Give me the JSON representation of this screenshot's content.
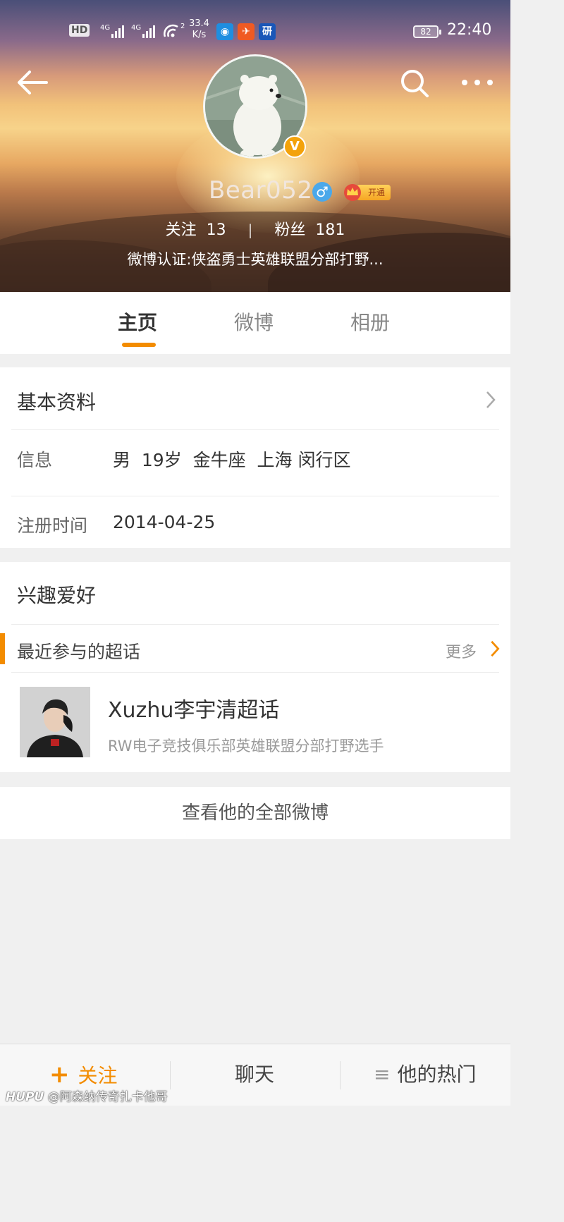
{
  "status_bar": {
    "hd": "HD",
    "net_1": "4G",
    "net_2": "4G",
    "hotspot_count": "2",
    "speed_value": "33.4",
    "speed_unit": "K/s",
    "app_badge_3": "研",
    "battery": "82",
    "time": "22:40"
  },
  "profile": {
    "name": "Bear052",
    "gender_symbol": "♂",
    "vip_label": "开通",
    "verified_badge": "V",
    "following_label": "关注",
    "following_count": "13",
    "separator": "|",
    "followers_label": "粉丝",
    "followers_count": "181",
    "verification": "微博认证:侠盗勇士英雄联盟分部打野..."
  },
  "tabs": [
    {
      "label": "主页",
      "active": true
    },
    {
      "label": "微博",
      "active": false
    },
    {
      "label": "相册",
      "active": false
    }
  ],
  "basic_info": {
    "title": "基本资料",
    "info_label": "信息",
    "info_value": "男  19岁  金牛座  上海 闵行区",
    "register_label": "注册时间",
    "register_value": "2014-04-25"
  },
  "interests": {
    "title": "兴趣爱好",
    "section_label": "最近参与的超话",
    "more": "更多",
    "topic": {
      "title": "Xuzhu李宇清超话",
      "subtitle": "RW电子竞技俱乐部英雄联盟分部打野选手"
    }
  },
  "all_posts": "查看他的全部微博",
  "bottom_bar": {
    "follow": "关注",
    "follow_icon": "+",
    "chat": "聊天",
    "hot": "他的热门",
    "hot_icon": "≡"
  },
  "watermark": {
    "brand": "HUPU",
    "text": "@阿森纳传奇扎卡他哥"
  },
  "colors": {
    "accent": "#f38c00",
    "verified_gold": "#f3a20b",
    "gender_blue": "#4aa8ea"
  }
}
